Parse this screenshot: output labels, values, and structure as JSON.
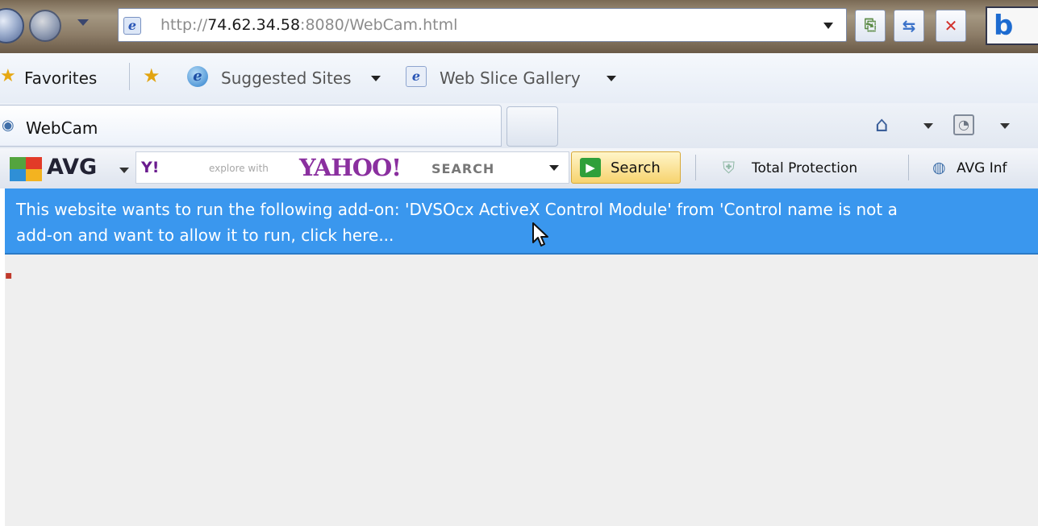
{
  "address_bar": {
    "url_scheme": "http://",
    "url_host": "74.62.34.58",
    "url_rest": ":8080/WebCam.html",
    "icons": [
      "back-icon",
      "forward-icon",
      "ie-page-icon",
      "compatibility-icon",
      "refresh-icon",
      "stop-icon",
      "bing-icon"
    ],
    "bing_letter": "b"
  },
  "favorites_bar": {
    "favorites_label": "Favorites",
    "suggested_sites_label": "Suggested Sites",
    "web_slice_label": "Web Slice Gallery"
  },
  "tab_bar": {
    "tabs": [
      {
        "label": "WebCam"
      }
    ]
  },
  "avg_toolbar": {
    "avg_label": "AVG",
    "yahoo_small": "Y!",
    "search_placeholder": "explore with",
    "yahoo_logo": "YAHOO!",
    "yahoo_search_word": "SEARCH",
    "search_button_label": "Search",
    "total_protection_label": "Total Protection",
    "avg_info_label": "AVG Inf"
  },
  "info_bar": {
    "line_1": "This website wants to run the following add-on: 'DVSOcx ActiveX Control Module' from 'Control name is not a",
    "line_2": "add-on and want to allow it to run, click here..."
  },
  "colors": {
    "info_bar_bg": "#3a97ee",
    "content_bg": "#efefef",
    "yahoo_purple": "#8a2f9f",
    "stop_red": "#d2312c"
  }
}
